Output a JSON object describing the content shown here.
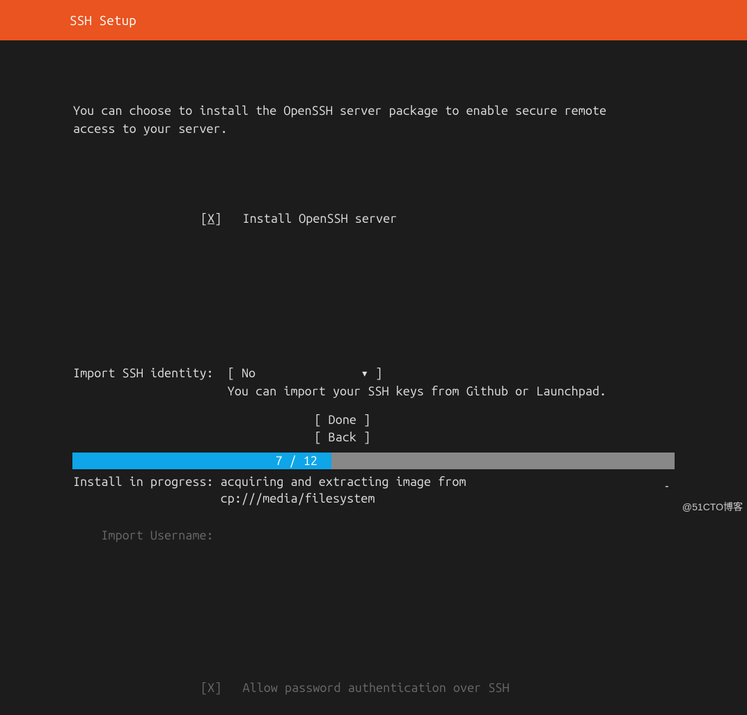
{
  "header": {
    "title": "SSH Setup"
  },
  "intro": {
    "line1": "You can choose to install the OpenSSH server package to enable secure remote",
    "line2": "access to your server."
  },
  "install_openssh": {
    "checkbox_value": "X",
    "label": "Install OpenSSH server"
  },
  "import_identity": {
    "label": "Import SSH identity:",
    "value": "No",
    "arrow": "▾",
    "hint": "You can import your SSH keys from Github or Launchpad."
  },
  "import_username": {
    "label": "Import Username:"
  },
  "allow_password": {
    "checkbox_value": "X",
    "label": "Allow password authentication over SSH"
  },
  "buttons": {
    "done": "Done",
    "back": "Back"
  },
  "progress": {
    "text": "7 / 12",
    "percent": 43
  },
  "status": {
    "line1": "Install in progress: acquiring and extracting image from",
    "line2": "cp:///media/filesystem",
    "dash": "-"
  },
  "watermark": "@51CTO博客"
}
